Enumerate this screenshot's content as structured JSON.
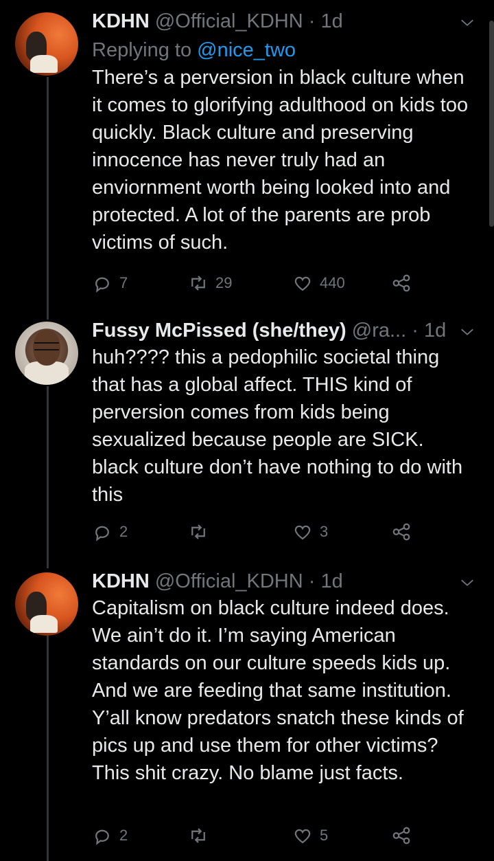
{
  "tweets": [
    {
      "name": "KDHN",
      "handle": "@Official_KDHN",
      "dot": "·",
      "time": "1d",
      "replying_prefix": "Replying to ",
      "replying_mention": "@nice_two",
      "text": "There’s a perversion in black culture when it comes to glorifying adulthood on kids too quickly. Black culture and preserving innocence has never truly had an enviornment worth being looked into and protected. A lot of the parents are prob victims of such.",
      "replies": "7",
      "retweets": "29",
      "likes": "440"
    },
    {
      "name": "Fussy McPissed (she/they)",
      "handle": "@ra...",
      "dot": "·",
      "time": "1d",
      "text": "huh???? this a pedophilic societal thing that has a global affect. THIS kind of perversion comes from kids being sexualized because people are SICK. black culture don’t have nothing to do with this",
      "replies": "2",
      "retweets": "",
      "likes": "3"
    },
    {
      "name": "KDHN",
      "handle": "@Official_KDHN",
      "dot": "·",
      "time": "1d",
      "text": "Capitalism on black culture indeed does. We ain’t do it. I’m saying American standards on our culture speeds kids up. And we are feeding that same institution. Y’all know predators snatch these kinds of pics up and use them for other victims? This shit crazy. No blame just facts.",
      "replies": "2",
      "retweets": "",
      "likes": "5"
    }
  ],
  "icons": {
    "reply": "reply-icon",
    "retweet": "retweet-icon",
    "like": "heart-icon",
    "share": "share-icon",
    "more": "chevron-down-icon"
  },
  "colors": {
    "background": "#000000",
    "text": "#e7e9ea",
    "muted": "#71767b",
    "link": "#1d9bf0",
    "thread_line": "#333639"
  }
}
